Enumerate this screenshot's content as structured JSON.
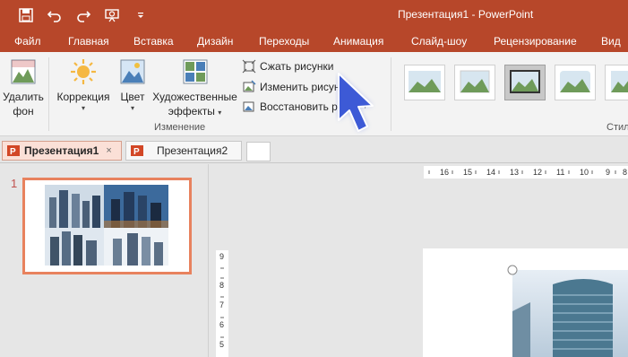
{
  "window": {
    "title": "Презентация1 - PowerPoint"
  },
  "quick_access": [
    {
      "name": "save-icon"
    },
    {
      "name": "undo-icon"
    },
    {
      "name": "redo-icon"
    },
    {
      "name": "slideshow-icon"
    },
    {
      "name": "customize-qat-icon"
    }
  ],
  "tabs": [
    "Файл",
    "Главная",
    "Вставка",
    "Дизайн",
    "Переходы",
    "Анимация",
    "Слайд-шоу",
    "Рецензирование",
    "Вид"
  ],
  "ribbon": {
    "remove_bg": {
      "line1": "Удалить",
      "line2": "фон"
    },
    "corrections": {
      "label": "Коррекция"
    },
    "color": {
      "label": "Цвет"
    },
    "artistic": {
      "line1": "Художественные",
      "line2": "эффекты"
    },
    "compress": "Сжать рисунки",
    "change": "Изменить рисун",
    "reset": "Восстановить ри",
    "adjust_group_label": "Изменение",
    "styles_group_label": "Стил"
  },
  "doc_tabs": {
    "active": "Презентация1",
    "second": "Презентация2",
    "close": "×"
  },
  "slides_pane": {
    "slide_number": "1"
  },
  "rulers": {
    "h_ticks": [
      "16",
      "15",
      "14",
      "13",
      "12",
      "11",
      "10",
      "9",
      "8"
    ],
    "v_ticks": [
      "9",
      "8",
      "7",
      "6",
      "5"
    ]
  },
  "colors": {
    "accent": "#b7472a",
    "thumb_border": "#e8825e",
    "cursor": "#3d5ad6"
  }
}
